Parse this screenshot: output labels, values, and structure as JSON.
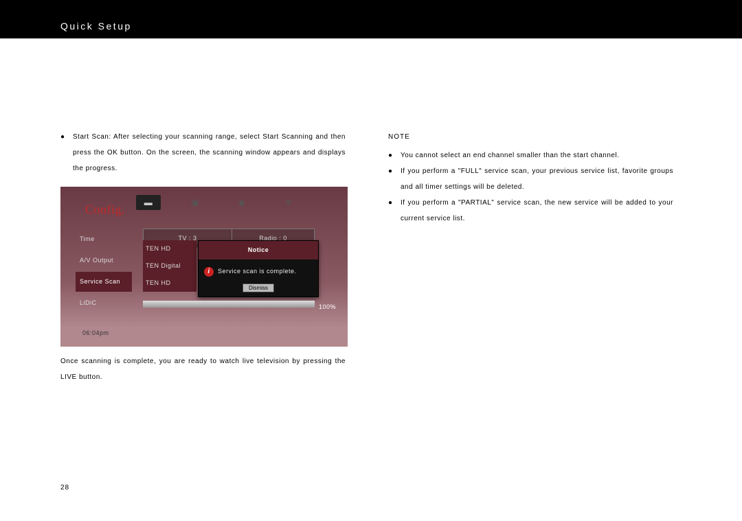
{
  "header": {
    "title": "Quick Setup"
  },
  "left_column": {
    "bullet1": "Start Scan: After selecting your scanning range, select Start Scanning and then press the OK button.  On the screen, the scanning window appears and displays the progress.",
    "after_screenshot": "Once scanning is complete, you are ready to watch live television by pressing the LIVE button."
  },
  "right_column": {
    "note_heading": "NOTE",
    "bullets": [
      "You cannot select an end channel smaller than the start channel.",
      "If you perform a \"FULL\" service scan, your previous service list, favorite groups and all timer settings will be deleted.",
      "If you perform a \"PARTIAL\" service scan, the new service will be added to your current service list."
    ]
  },
  "screenshot": {
    "config_label": "Config.",
    "sidebar": [
      "Time",
      "A/V Output",
      "Service Scan",
      "LiDiC"
    ],
    "sidebar_selected_index": 2,
    "tv_label": "TV : 3",
    "radio_label": "Radio : 0",
    "channels": [
      "TEN HD",
      "TEN Digital",
      "TEN HD"
    ],
    "notice_header": "Notice",
    "notice_body": "Service scan is complete.",
    "notice_button": "Dismiss",
    "progress_pct": "100%",
    "clock": "06:04pm"
  },
  "page_number": "28"
}
